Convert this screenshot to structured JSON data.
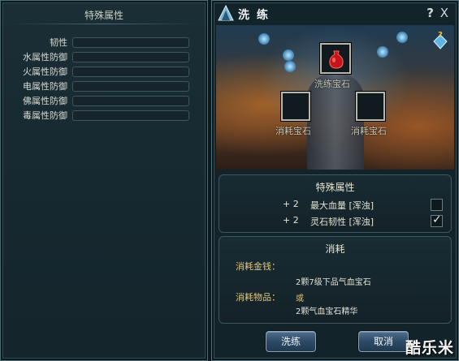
{
  "left_panel": {
    "title": "特殊属性",
    "attributes": [
      {
        "label": "韧性",
        "value": ""
      },
      {
        "label": "水属性防御",
        "value": ""
      },
      {
        "label": "火属性防御",
        "value": ""
      },
      {
        "label": "电属性防御",
        "value": ""
      },
      {
        "label": "佛属性防御",
        "value": ""
      },
      {
        "label": "毒属性防御",
        "value": ""
      }
    ]
  },
  "dialog": {
    "title": "洗 练",
    "help": "?",
    "close": "X",
    "slots": {
      "main_label": "洗练宝石",
      "left_label": "消耗宝石",
      "right_label": "消耗宝石"
    },
    "special": {
      "title": "特殊属性",
      "rows": [
        {
          "plus": "+ 2",
          "name": "最大血量 [浑浊]",
          "checked": false
        },
        {
          "plus": "+ 2",
          "name": "灵石韧性 [浑浊]",
          "checked": true
        }
      ],
      "check_mark": "✓"
    },
    "cost": {
      "title": "消耗",
      "money_label": "消耗金钱：",
      "money_value": "2颗7级下品气血宝石",
      "item_label": "消耗物品：",
      "item_or": "或",
      "item_value": "2颗气血宝石精华"
    },
    "buttons": {
      "ok": "洗练",
      "cancel": "取消"
    }
  },
  "watermark": "酷乐米",
  "colors": {
    "gold_label": "#e3c77a",
    "panel_bg": "#13232a",
    "button_blue": "#2d4a66"
  }
}
